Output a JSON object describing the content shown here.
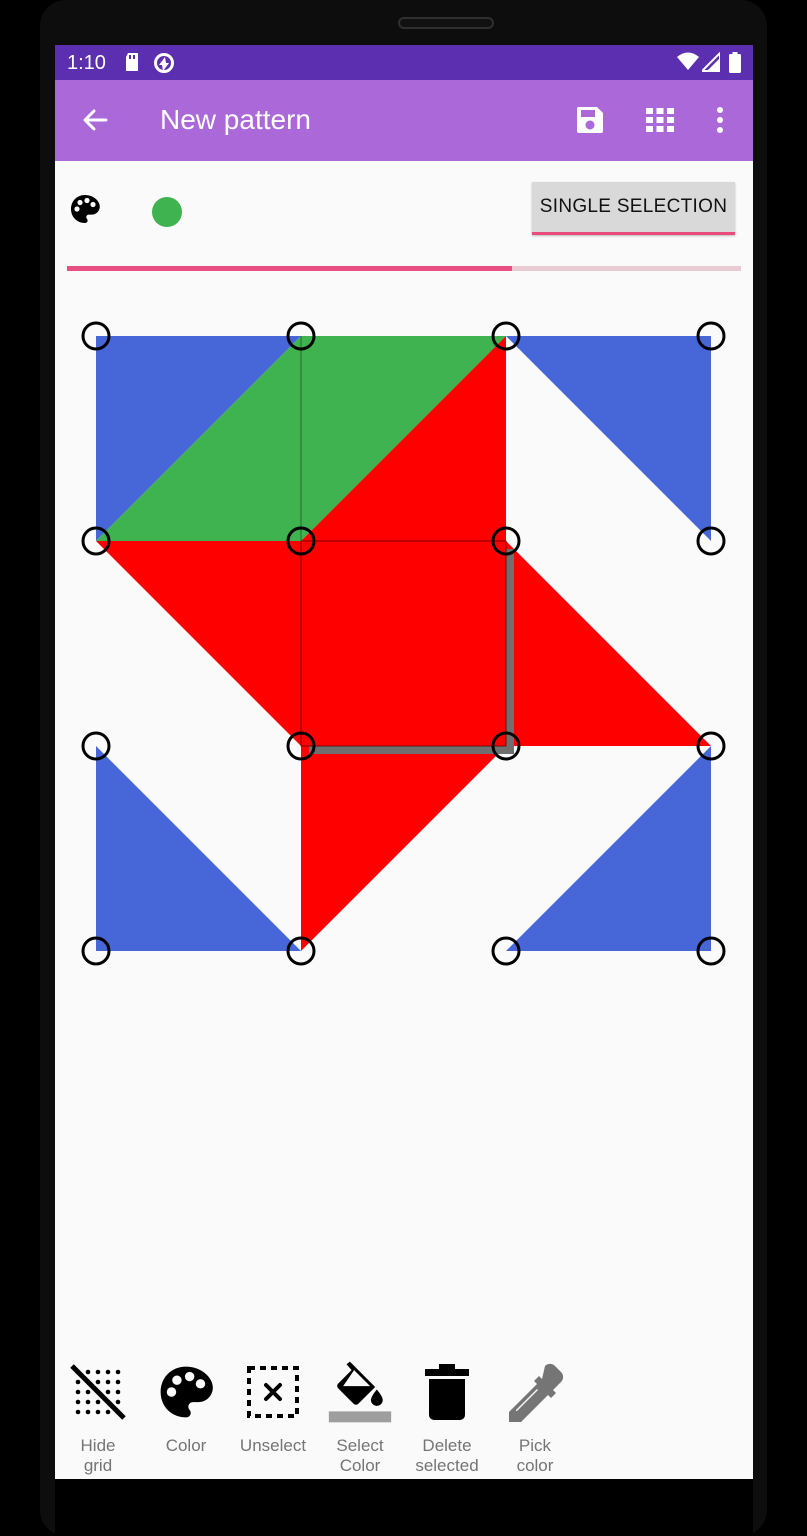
{
  "status_bar": {
    "time": "1:10",
    "icons": [
      "sd-card-icon",
      "sync-icon",
      "wifi-icon",
      "signal-icon",
      "battery-icon"
    ]
  },
  "app_bar": {
    "title": "New pattern",
    "actions": [
      "save-icon",
      "grid-icon",
      "more-vert-icon"
    ]
  },
  "toolbar": {
    "current_color": "#3fb34f",
    "selection_mode_label": "SINGLE SELECTION"
  },
  "progress": {
    "value": 0.66,
    "color": "#ea4f83"
  },
  "colors": {
    "blue": "#4766d8",
    "green": "#3fb34f",
    "red": "#ff0000"
  },
  "bottom_actions": [
    {
      "label": "Hide\ngrid",
      "icon": "hide-grid-icon"
    },
    {
      "label": "Color",
      "icon": "palette-icon"
    },
    {
      "label": "Unselect",
      "icon": "unselect-icon"
    },
    {
      "label": "Select\nColor",
      "icon": "fill-bucket-icon"
    },
    {
      "label": "Delete\nselected",
      "icon": "trash-icon"
    },
    {
      "label": "Pick\ncolor",
      "icon": "eyedropper-icon"
    }
  ]
}
